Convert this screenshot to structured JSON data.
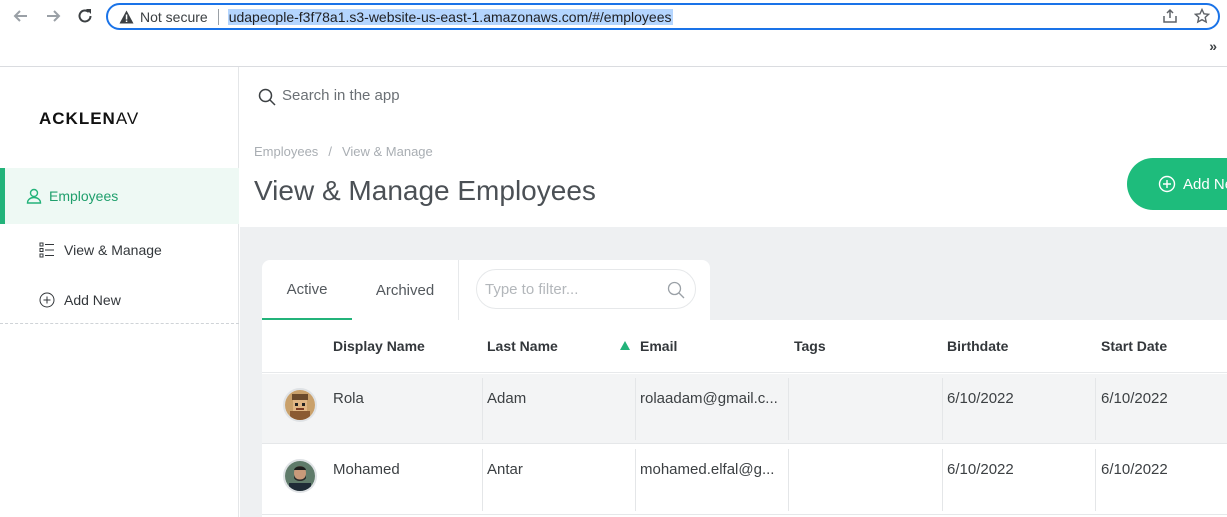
{
  "browser": {
    "security_label": "Not secure",
    "url": "udapeople-f3f78a1.s3-website-us-east-1.amazonaws.com/#/employees",
    "more_label": "»"
  },
  "sidebar": {
    "logo_main": "ACKLEN",
    "logo_tail": "AV",
    "items": [
      {
        "label": "Employees",
        "icon": "user-icon",
        "active": true
      },
      {
        "label": "View & Manage",
        "icon": "list-icon",
        "active": false
      },
      {
        "label": "Add New",
        "icon": "plus-circle-icon",
        "active": false
      }
    ]
  },
  "search": {
    "placeholder": "Search in the app"
  },
  "header": {
    "breadcrumb": [
      "Employees",
      "View & Manage"
    ],
    "breadcrumb_sep": "/",
    "title": "View & Manage Employees",
    "add_button": "Add Ne"
  },
  "tabs": [
    {
      "label": "Active"
    },
    {
      "label": "Archived"
    }
  ],
  "filter": {
    "placeholder": "Type to filter..."
  },
  "table": {
    "columns": [
      "Display Name",
      "Last Name",
      "Email",
      "Tags",
      "Birthdate",
      "Start Date"
    ],
    "sorted_column": "Email",
    "rows": [
      {
        "display_name": "Rola",
        "last_name": "Adam",
        "email": "rolaadam@gmail.c...",
        "tags": "",
        "birthdate": "6/10/2022",
        "start_date": "6/10/2022"
      },
      {
        "display_name": "Mohamed",
        "last_name": "Antar",
        "email": "mohamed.elfal@g...",
        "tags": "",
        "birthdate": "6/10/2022",
        "start_date": "6/10/2022"
      }
    ]
  },
  "colors": {
    "accent": "#23b37a",
    "button": "#1ebc7c",
    "active_bg": "#eef9f4"
  }
}
